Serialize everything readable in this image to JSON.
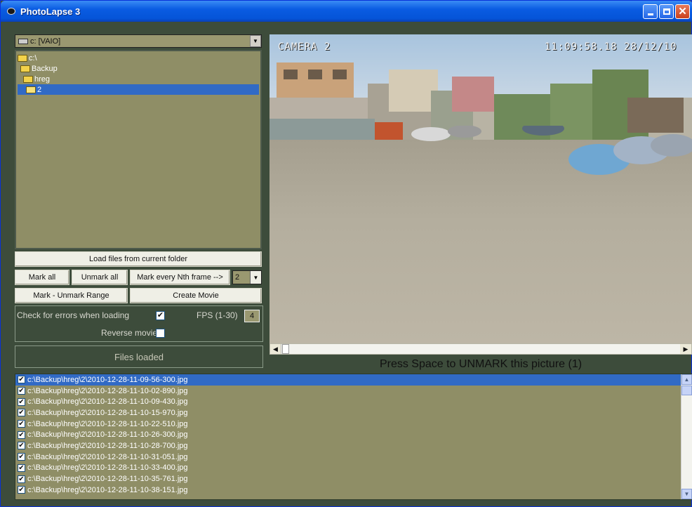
{
  "window": {
    "title": "PhotoLapse 3"
  },
  "drive": {
    "label": "c: [VAIO]"
  },
  "tree": [
    {
      "label": "c:\\",
      "indent": 0,
      "selected": false
    },
    {
      "label": "Backup",
      "indent": 1,
      "selected": false
    },
    {
      "label": "hreg",
      "indent": 2,
      "selected": false
    },
    {
      "label": "2",
      "indent": 3,
      "selected": true
    }
  ],
  "buttons": {
    "load": "Load files from current folder",
    "mark_all": "Mark all",
    "unmark_all": "Unmark all",
    "mark_nth": "Mark every Nth frame -->",
    "mark_range": "Mark - Unmark Range",
    "create_movie": "Create Movie"
  },
  "nth_value": "2",
  "options": {
    "check_errors_label": "Check for errors when loading",
    "check_errors_checked": true,
    "fps_label": "FPS (1-30)",
    "fps_value": "4",
    "reverse_label": "Reverse movie",
    "reverse_checked": false
  },
  "status": {
    "files_loaded": "Files loaded"
  },
  "preview": {
    "camera_label": "CAMERA 2",
    "timestamp": "11:09:58.18 28/12/10"
  },
  "press_text": "Press Space to UNMARK this picture (1)",
  "files": [
    {
      "path": "c:\\Backup\\hreg\\2\\2010-12-28-11-09-56-300.jpg",
      "checked": true,
      "selected": true
    },
    {
      "path": "c:\\Backup\\hreg\\2\\2010-12-28-11-10-02-890.jpg",
      "checked": true,
      "selected": false
    },
    {
      "path": "c:\\Backup\\hreg\\2\\2010-12-28-11-10-09-430.jpg",
      "checked": true,
      "selected": false
    },
    {
      "path": "c:\\Backup\\hreg\\2\\2010-12-28-11-10-15-970.jpg",
      "checked": true,
      "selected": false
    },
    {
      "path": "c:\\Backup\\hreg\\2\\2010-12-28-11-10-22-510.jpg",
      "checked": true,
      "selected": false
    },
    {
      "path": "c:\\Backup\\hreg\\2\\2010-12-28-11-10-26-300.jpg",
      "checked": true,
      "selected": false
    },
    {
      "path": "c:\\Backup\\hreg\\2\\2010-12-28-11-10-28-700.jpg",
      "checked": true,
      "selected": false
    },
    {
      "path": "c:\\Backup\\hreg\\2\\2010-12-28-11-10-31-051.jpg",
      "checked": true,
      "selected": false
    },
    {
      "path": "c:\\Backup\\hreg\\2\\2010-12-28-11-10-33-400.jpg",
      "checked": true,
      "selected": false
    },
    {
      "path": "c:\\Backup\\hreg\\2\\2010-12-28-11-10-35-761.jpg",
      "checked": true,
      "selected": false
    },
    {
      "path": "c:\\Backup\\hreg\\2\\2010-12-28-11-10-38-151.jpg",
      "checked": true,
      "selected": false
    }
  ]
}
